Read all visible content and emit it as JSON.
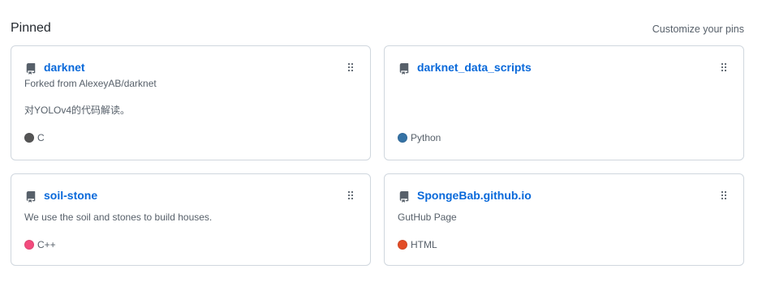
{
  "heading": "Pinned",
  "customize_label": "Customize your pins",
  "cards": [
    {
      "name": "darknet",
      "forked_from": "Forked from AlexeyAB/darknet",
      "description": "对YOLOv4的代码解读。",
      "language": "C",
      "language_color": "#555555"
    },
    {
      "name": "darknet_data_scripts",
      "forked_from": "",
      "description": "",
      "language": "Python",
      "language_color": "#3572A5"
    },
    {
      "name": "soil-stone",
      "forked_from": "",
      "description": "We use the soil and stones to build houses.",
      "language": "C++",
      "language_color": "#f34b7d"
    },
    {
      "name": "SpongeBab.github.io",
      "forked_from": "",
      "description": "GutHub Page",
      "language": "HTML",
      "language_color": "#e34c26"
    }
  ],
  "icons": {
    "repo": "repo-icon",
    "drag": "grabber-icon"
  }
}
